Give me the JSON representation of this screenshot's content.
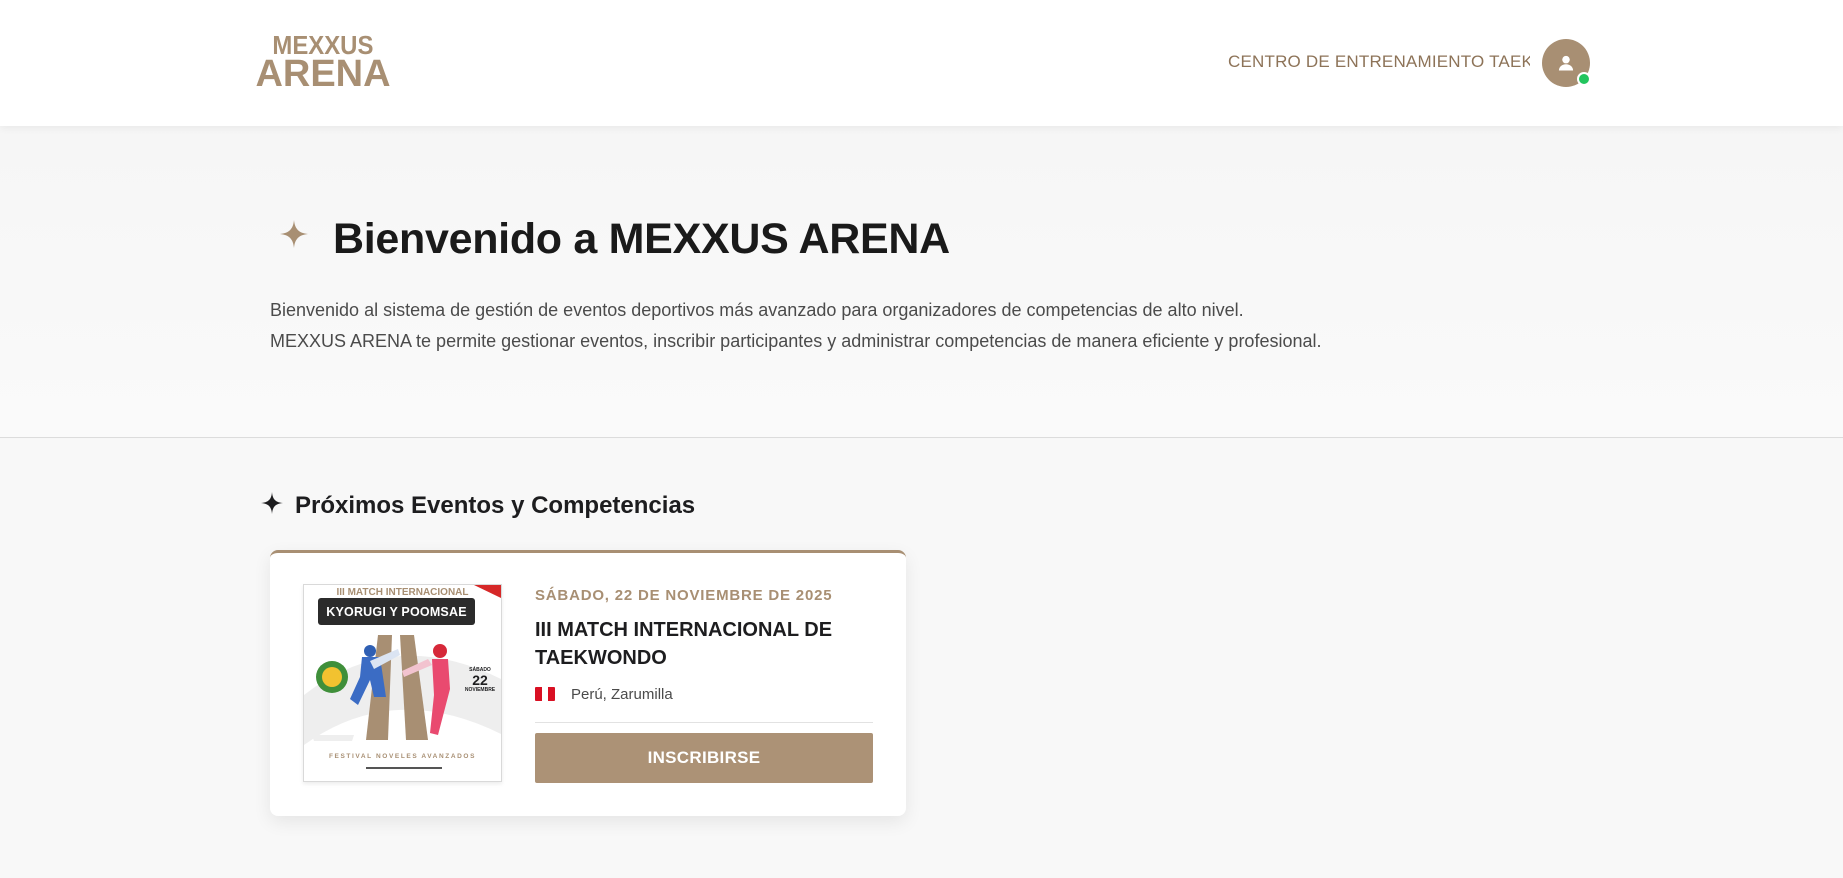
{
  "header": {
    "logo_line1": "MEXXUS",
    "logo_line2": "ARENA",
    "user_center": "CENTRO DE ENTRENAMIENTO TAEKWONDO",
    "avatar_icon": "user-icon",
    "status": "online",
    "status_color": "#22c55e"
  },
  "hero": {
    "icon": "sparkle-icon",
    "title": "Bienvenido a MEXXUS ARENA",
    "paragraph_line1": "Bienvenido al sistema de gestión de eventos deportivos más avanzado para organizadores de competencias de alto nivel.",
    "paragraph_line2": "MEXXUS ARENA te permite gestionar eventos, inscribir participantes y administrar competencias de manera eficiente y profesional."
  },
  "events": {
    "icon": "sparkle-icon",
    "section_title": "Próximos Eventos y Competencias",
    "items": [
      {
        "badge": "KYORUGI Y POOMSAE",
        "poster_headline": "III MATCH INTERNACIONAL",
        "poster_festival": "FESTIVAL NOVELES AVANZADOS",
        "poster_date_num": "22",
        "poster_date_top": "SÁBADO",
        "poster_date_bottom": "NOVIEMBRE",
        "date": "SÁBADO, 22 DE NOVIEMBRE DE 2025",
        "title": "III MATCH INTERNACIONAL DE TAEKWONDO",
        "flag": "peru-flag-icon",
        "location": "Perú, Zarumilla",
        "button_label": "INSCRIBIRSE"
      }
    ]
  },
  "colors": {
    "accent": "#a88f73",
    "button": "#ac9276",
    "text": "#1d1d1f"
  }
}
